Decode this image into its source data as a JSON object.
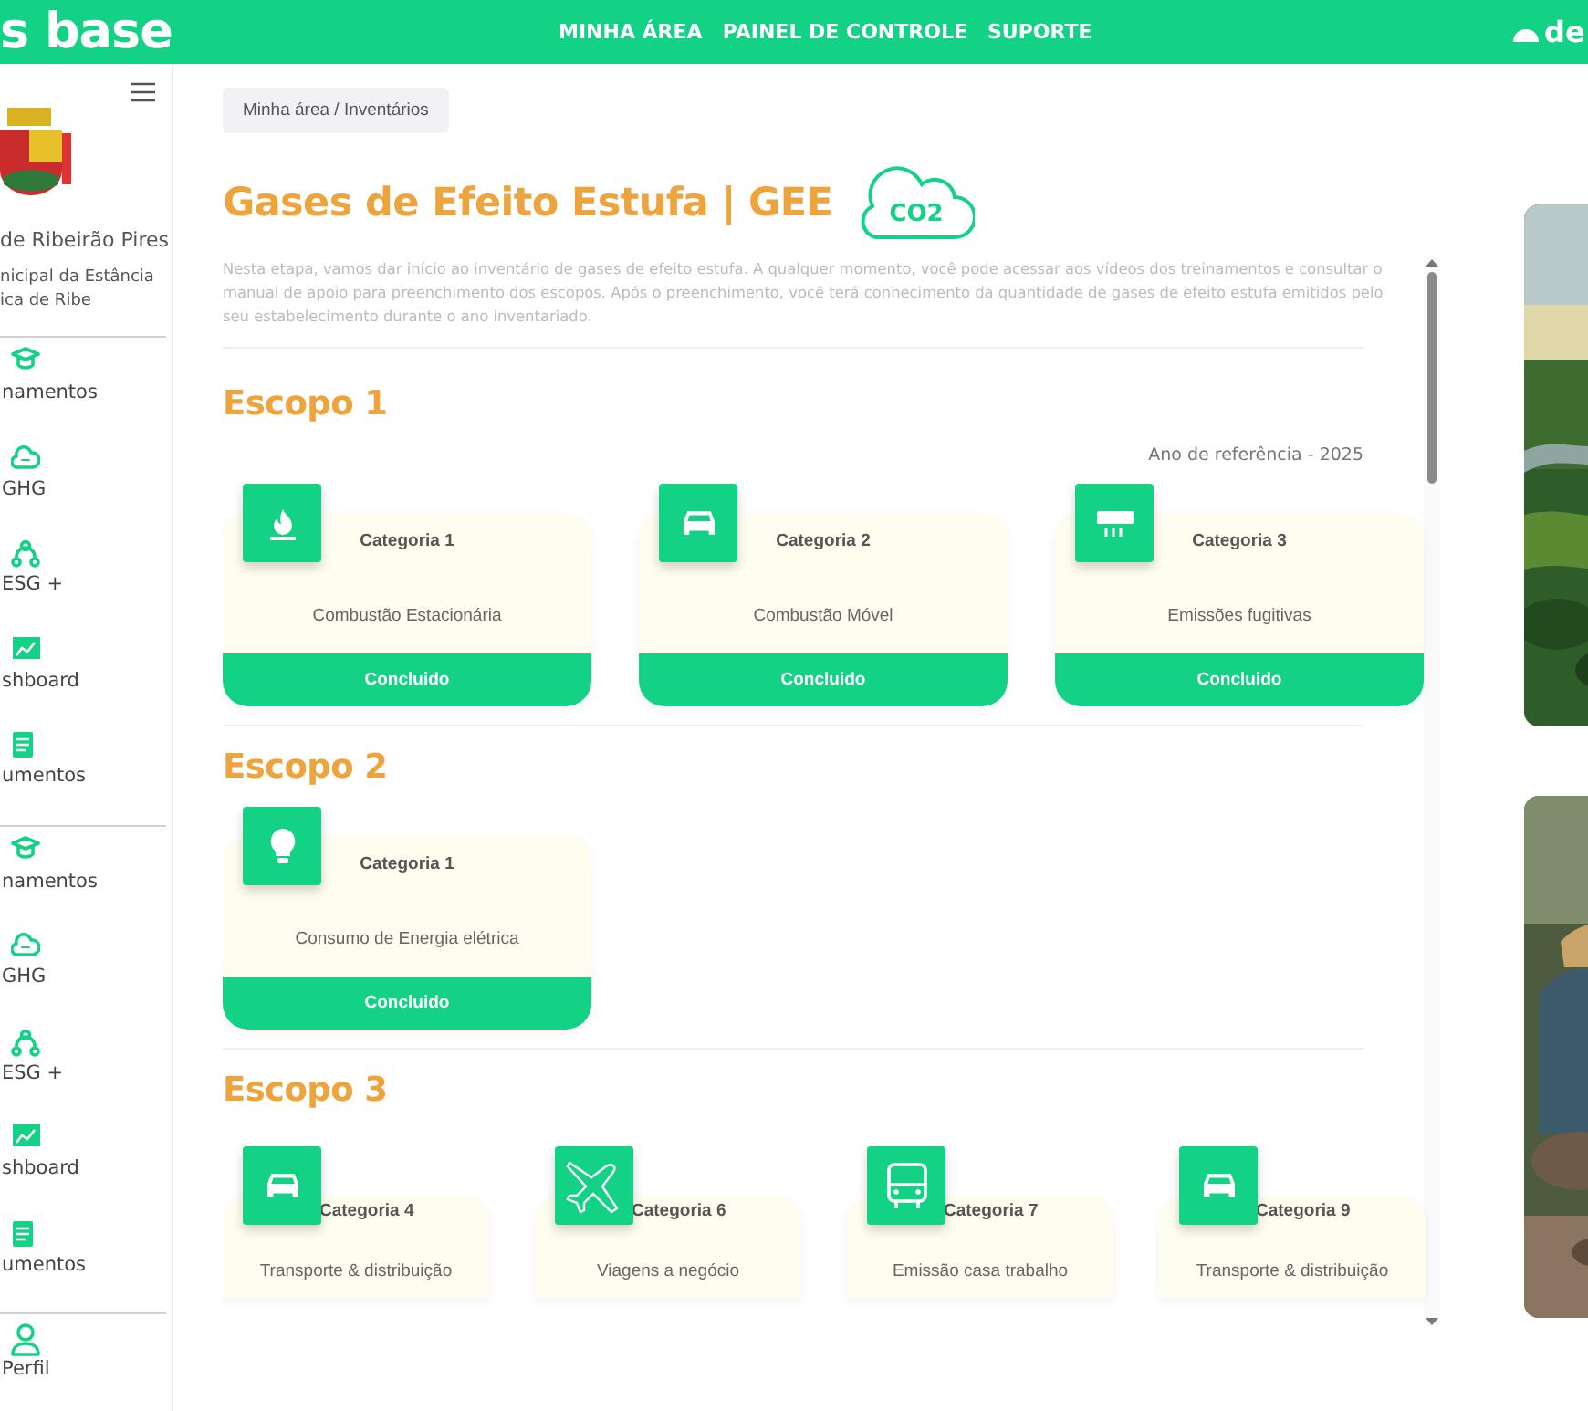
{
  "header": {
    "brand": "s base",
    "nav": [
      {
        "label": "MINHA ÁREA"
      },
      {
        "label": "PAINEL DE CONTROLE"
      },
      {
        "label": "SUPORTE"
      }
    ],
    "logo_text": "de"
  },
  "sidebar": {
    "org_name": "de Ribeirão Pires",
    "org_subtitle": [
      "nicipal da Estância",
      "ica de Ribe"
    ],
    "groups": [
      {
        "items": [
          {
            "label": "namentos"
          },
          {
            "label": "GHG"
          },
          {
            "label": "ESG +"
          },
          {
            "label": "shboard"
          },
          {
            "label": "umentos"
          }
        ]
      },
      {
        "items": [
          {
            "label": "namentos"
          },
          {
            "label": "GHG"
          },
          {
            "label": "ESG +"
          },
          {
            "label": "shboard"
          },
          {
            "label": "umentos"
          }
        ]
      }
    ],
    "profile": {
      "label": "Perfil"
    }
  },
  "breadcrumb": "Minha área / Inventários",
  "title": "Gases de Efeito Estufa | GEE",
  "co2": "CO2",
  "description": "Nesta etapa, vamos dar início ao inventário de gases de efeito estufa. A qualquer momento, você pode acessar aos vídeos dos treinamentos e consultar o manual de apoio para preenchimento dos escopos. Após o preenchimento, você terá conhecimento da quantidade de gases de efeito estufa emitidos pelo seu estabelecimento durante o ano inventariado.",
  "reference_year": "Ano de referência - 2025",
  "scopes": [
    {
      "title": "Escopo 1",
      "cards": [
        {
          "category": "Categoria 1",
          "name": "Combustão Estacionária",
          "status": "Concluido"
        },
        {
          "category": "Categoria 2",
          "name": "Combustão Móvel",
          "status": "Concluido"
        },
        {
          "category": "Categoria 3",
          "name": "Emissões fugitivas",
          "status": "Concluido"
        }
      ]
    },
    {
      "title": "Escopo 2",
      "cards": [
        {
          "category": "Categoria 1",
          "name": "Consumo de Energia elétrica",
          "status": "Concluido"
        }
      ]
    },
    {
      "title": "Escopo 3",
      "compact": true,
      "cards": [
        {
          "category": "Categoria 4",
          "name": "Transporte & distribuição"
        },
        {
          "category": "Categoria 6",
          "name": "Viagens a negócio"
        },
        {
          "category": "Categoria 7",
          "name": "Emissão casa trabalho"
        },
        {
          "category": "Categoria 9",
          "name": "Transporte & distribuição"
        }
      ]
    }
  ]
}
